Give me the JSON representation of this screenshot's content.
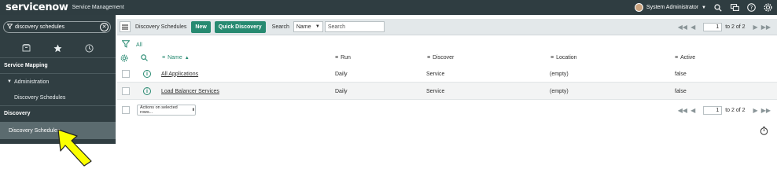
{
  "banner": {
    "logo": "servicenow",
    "product": "Service Management",
    "user": "System Administrator"
  },
  "nav": {
    "filter_value": "discovery schedules",
    "sections": [
      {
        "label": "Service Mapping"
      },
      {
        "label": "Discovery"
      }
    ],
    "modules": {
      "administration": "Administration",
      "admin_discovery_schedules": "Discovery Schedules",
      "discovery_schedules": "Discovery Schedules"
    },
    "colors": {
      "bg": "#303e42",
      "selected": "#5b6b6f"
    }
  },
  "listbar": {
    "title": "Discovery Schedules",
    "new_label": "New",
    "quick_discovery_label": "Quick Discovery",
    "search_label": "Search",
    "search_field": "Name",
    "search_placeholder": "Search",
    "page": "1",
    "page_text": "to 2 of 2"
  },
  "breadcrumb": {
    "all": "All"
  },
  "columns": [
    "Name",
    "Run",
    "Discover",
    "Location",
    "Active"
  ],
  "rows": [
    {
      "name": "All Applications",
      "run": "Daily",
      "discover": "Service",
      "location": "(empty)",
      "active": "false"
    },
    {
      "name": "Load Balancer Services",
      "run": "Daily",
      "discover": "Service",
      "location": "(empty)",
      "active": "false"
    }
  ],
  "footer": {
    "actions_label": "Actions on selected rows...",
    "page": "1",
    "page_text": "to 2 of 2"
  },
  "accent": "#278a71",
  "annotation_color": "#fbff00"
}
